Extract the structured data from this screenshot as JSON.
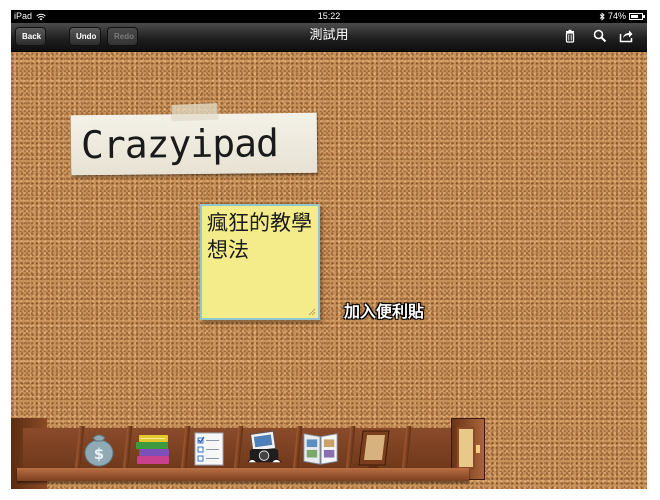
{
  "status_bar": {
    "device": "iPad",
    "time": "15:22",
    "battery": "74%",
    "battery_level": 0.74
  },
  "nav": {
    "back_label": "Back",
    "undo_label": "Undo",
    "redo_label": "Redo",
    "title": "測試用"
  },
  "board": {
    "label_card_text": "Crazyipad",
    "sticky_note_text": "瘋狂的教學想法",
    "hint_text": "加入便利貼"
  },
  "icons": {
    "nav": [
      "trash-icon",
      "search-icon",
      "share-icon"
    ],
    "shelf": [
      "money-bag-icon",
      "books-icon",
      "checklist-icon",
      "photo-camera-icon",
      "photo-album-icon",
      "picture-frame-icon",
      "cabinet-icon"
    ]
  },
  "colors": {
    "cork": "#c9915a",
    "sticky_fill": "#f4ec8a",
    "sticky_border": "#8fc7cf",
    "shelf_wood": "#8a4b2b"
  }
}
